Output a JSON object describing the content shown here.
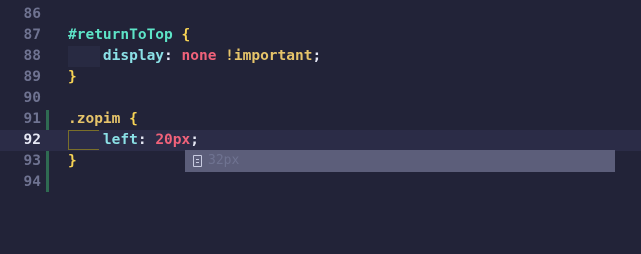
{
  "lines": [
    {
      "number": "86"
    },
    {
      "number": "87",
      "selector": "#returnToTop",
      "brace": "{"
    },
    {
      "number": "88",
      "property": "display",
      "colon": ":",
      "value": "none",
      "important": "!important",
      "semicolon": ";"
    },
    {
      "number": "89",
      "brace": "}"
    },
    {
      "number": "90"
    },
    {
      "number": "91",
      "selector": ".zopim",
      "brace": "{"
    },
    {
      "number": "92",
      "property": "left",
      "colon": ":",
      "value": "20px",
      "semicolon": ";"
    },
    {
      "number": "93",
      "brace": "}"
    },
    {
      "number": "94"
    }
  ],
  "suggestion": {
    "icon": "snippet-icon",
    "text": "32px"
  },
  "colors": {
    "background": "#222338",
    "selector": "#5de4c7",
    "brace": "#f7d354",
    "property": "#8be0e6",
    "keyword": "#f0627a",
    "git_added": "#2f6b52",
    "suggest_bg": "#5c5e7a"
  }
}
